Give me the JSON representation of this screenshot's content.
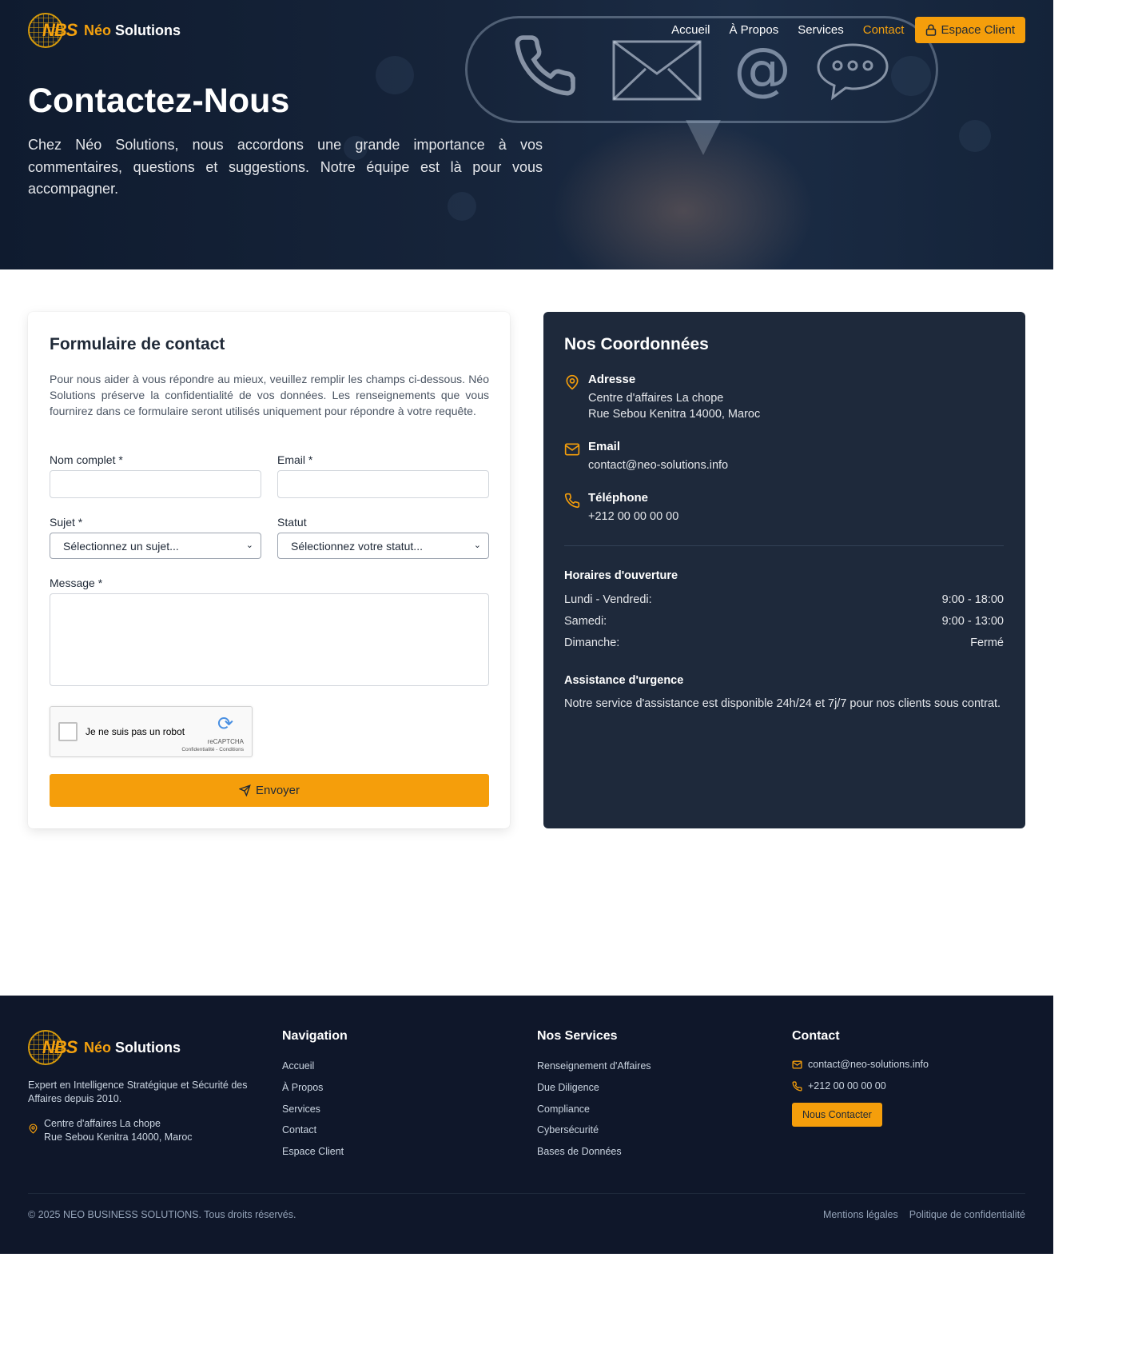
{
  "brand": {
    "short": "NBS",
    "name_accent": "Néo",
    "name_rest": "Solutions"
  },
  "nav": {
    "links": [
      "Accueil",
      "À Propos",
      "Services",
      "Contact"
    ],
    "active": "Contact",
    "client_button": "Espace Client"
  },
  "hero": {
    "title": "Contactez-Nous",
    "text": "Chez Néo Solutions, nous accordons une grande importance à vos commentaires, questions et suggestions. Notre équipe est là pour vous accompagner.",
    "decor_icons": [
      "phone-icon",
      "envelope-icon",
      "at-sign-icon",
      "chat-bubble-icon"
    ]
  },
  "form": {
    "title": "Formulaire de contact",
    "intro": "Pour nous aider à vous répondre au mieux, veuillez remplir les champs ci-dessous. Néo Solutions préserve la confidentialité de vos données. Les renseignements que vous fournirez dans ce formulaire seront utilisés uniquement pour répondre à votre requête.",
    "name_label": "Nom complet *",
    "name_value": "",
    "email_label": "Email *",
    "email_value": "",
    "subject_label": "Sujet *",
    "subject_selected": "Sélectionnez un sujet...",
    "status_label": "Statut",
    "status_selected": "Sélectionnez votre statut...",
    "message_label": "Message *",
    "message_value": "",
    "recaptcha": {
      "label": "Je ne suis pas un robot",
      "brand": "reCAPTCHA",
      "links": "Confidentialité - Conditions",
      "checked": false
    },
    "submit_label": "Envoyer"
  },
  "info": {
    "title": "Nos Coordonnées",
    "address_label": "Adresse",
    "address_line1": "Centre d'affaires La chope",
    "address_line2": "Rue Sebou Kenitra 14000, Maroc",
    "email_label": "Email",
    "email_value": "contact@neo-solutions.info",
    "phone_label": "Téléphone",
    "phone_value": "+212 00 00 00 00",
    "hours_title": "Horaires d'ouverture",
    "hours": [
      {
        "day": "Lundi - Vendredi:",
        "time": "9:00 - 18:00"
      },
      {
        "day": "Samedi:",
        "time": "9:00 - 13:00"
      },
      {
        "day": "Dimanche:",
        "time": "Fermé"
      }
    ],
    "assist_title": "Assistance d'urgence",
    "assist_text": "Notre service d'assistance est disponible 24h/24 et 7j/7 pour nos clients sous contrat."
  },
  "footer": {
    "description": "Expert en Intelligence Stratégique et Sécurité des Affaires depuis 2010.",
    "address_line1": "Centre d'affaires La chope",
    "address_line2": "Rue Sebou Kenitra 14000, Maroc",
    "nav_title": "Navigation",
    "nav_links": [
      "Accueil",
      "À Propos",
      "Services",
      "Contact",
      "Espace Client"
    ],
    "services_title": "Nos Services",
    "services_links": [
      "Renseignement d'Affaires",
      "Due Diligence",
      "Compliance",
      "Cybersécurité",
      "Bases de Données"
    ],
    "contact_title": "Contact",
    "contact_email": "contact@neo-solutions.info",
    "contact_phone": "+212 00 00 00 00",
    "contact_button": "Nous Contacter",
    "copyright": "© 2025 NEO BUSINESS SOLUTIONS. Tous droits réservés.",
    "legal_links": [
      "Mentions légales",
      "Politique de confidentialité"
    ]
  },
  "colors": {
    "accent": "#f59e0b",
    "dark_card": "#1e293b",
    "footer": "#0f172a",
    "hero": "#16243a"
  }
}
